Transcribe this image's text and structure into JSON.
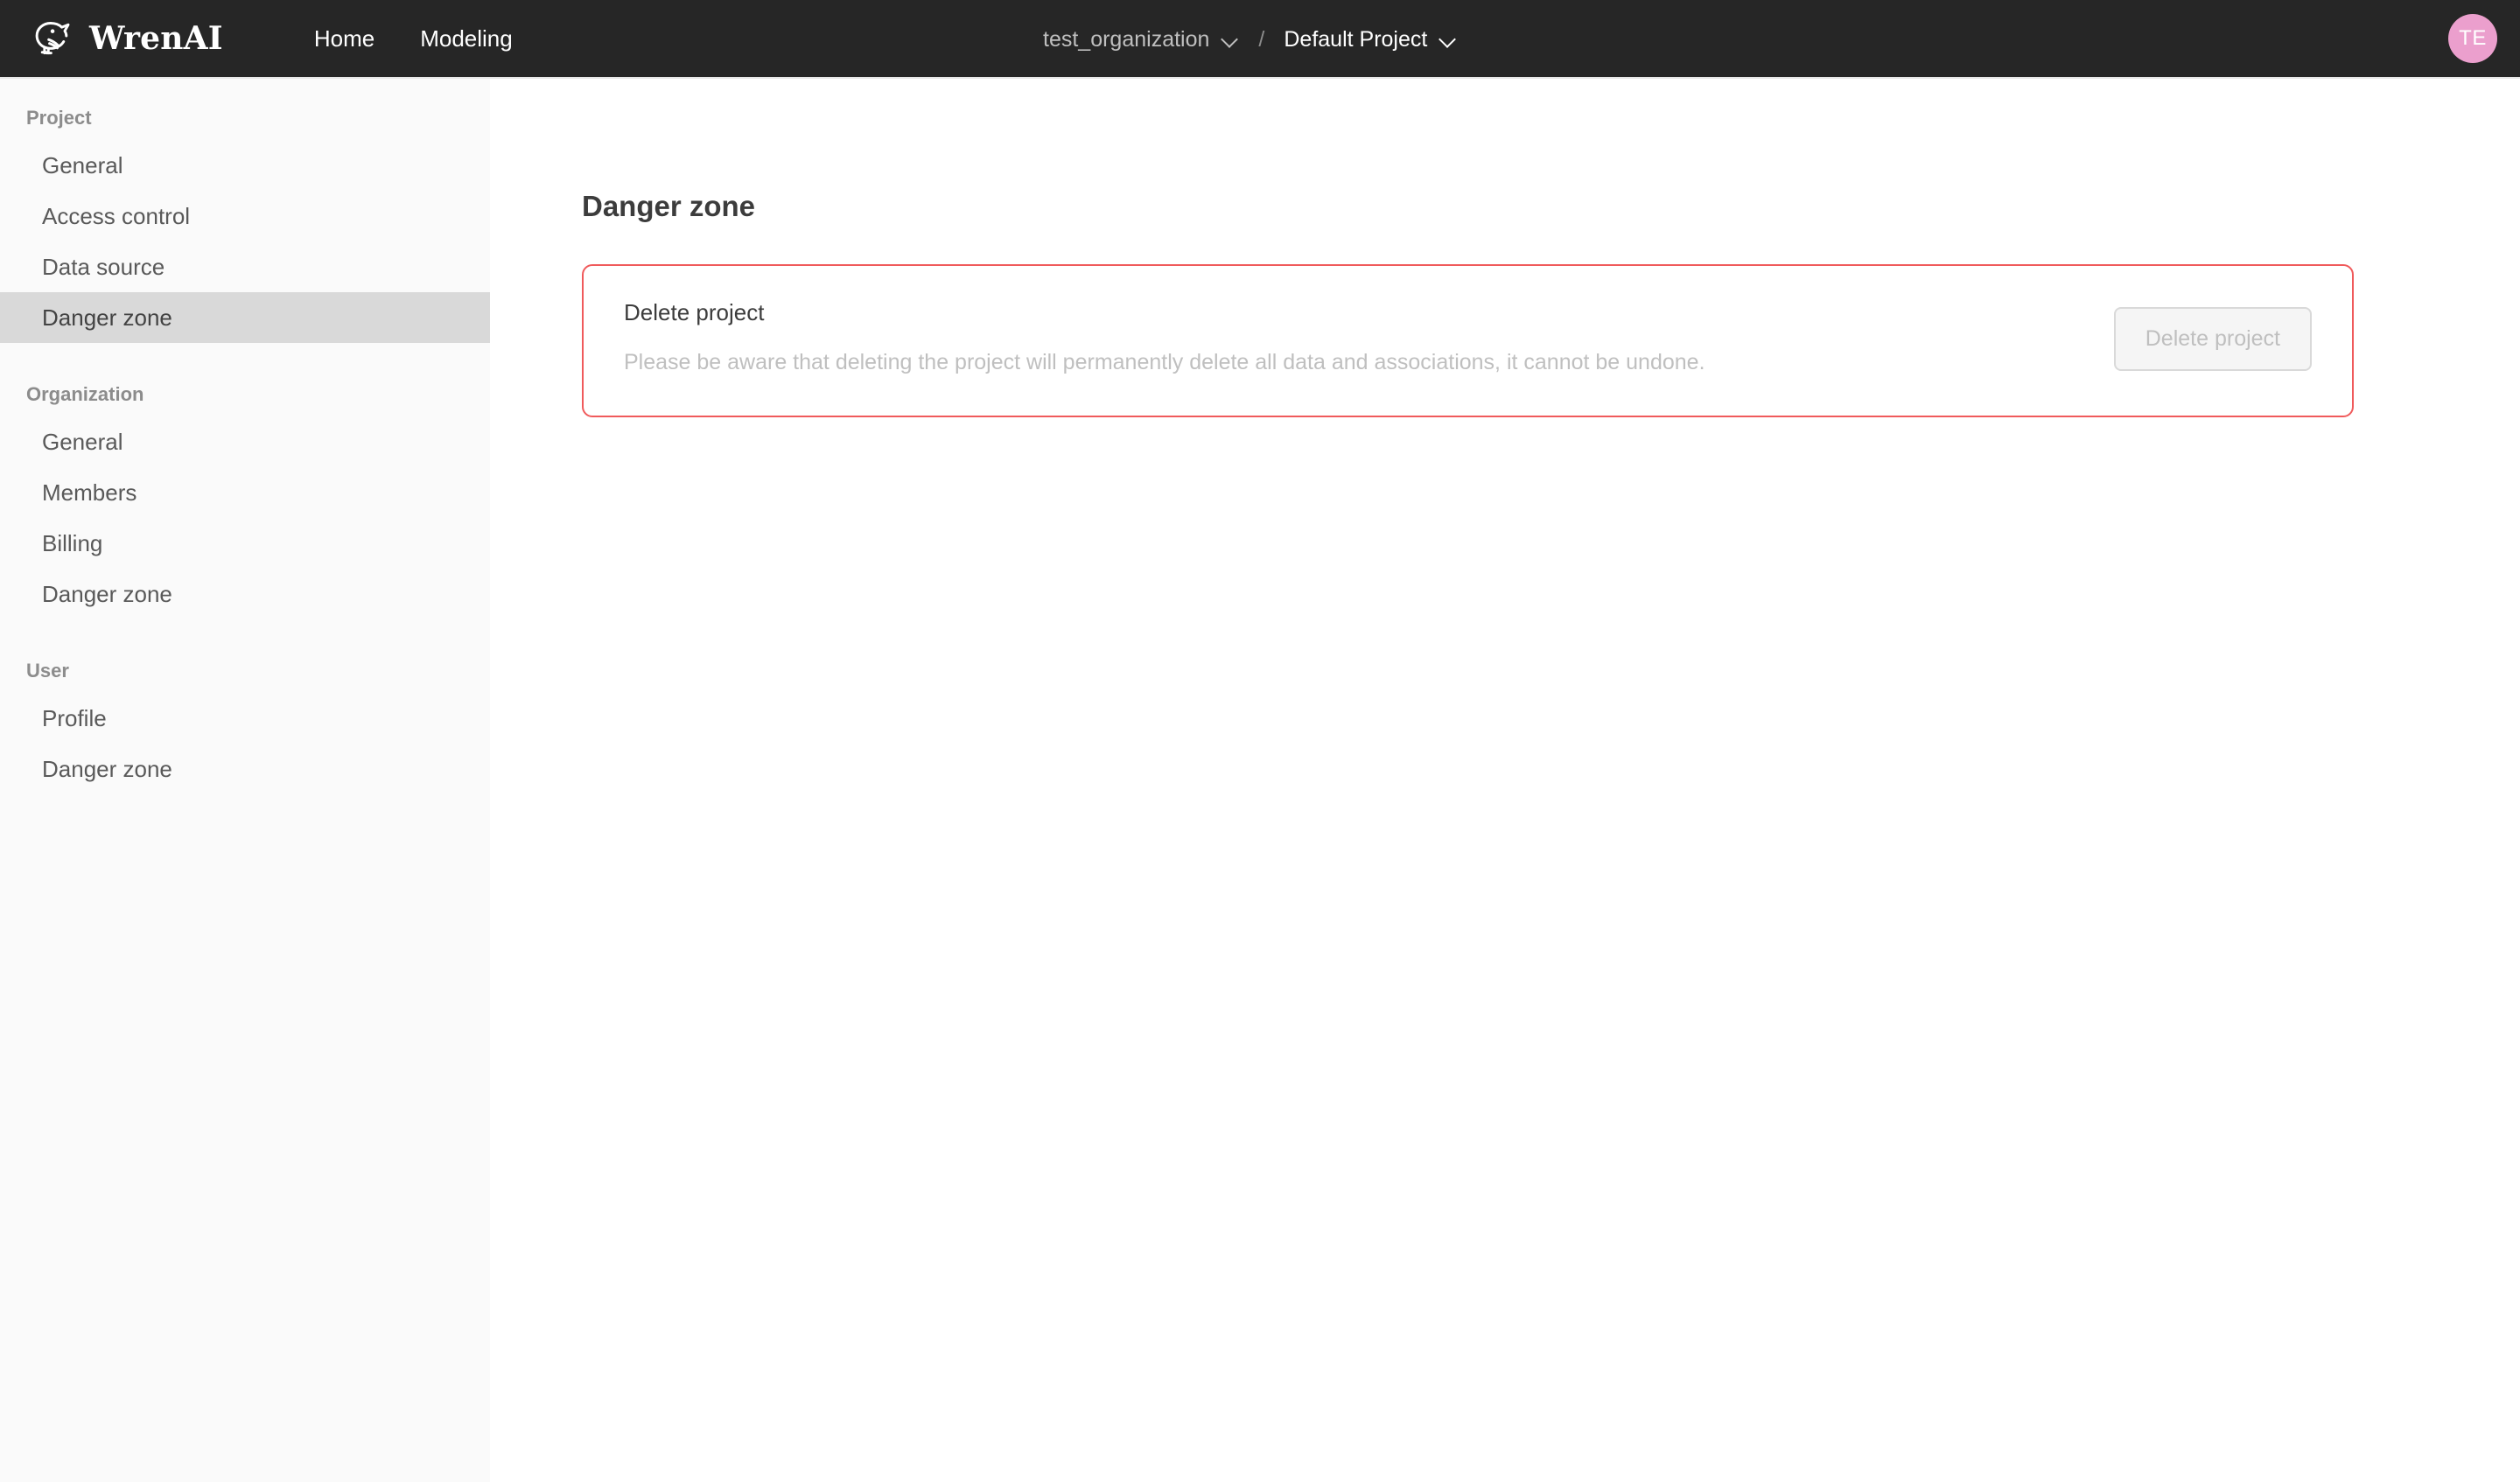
{
  "header": {
    "brand_name": "WrenAI",
    "brand_logo_icon": "wren-bird-icon",
    "nav": [
      {
        "label": "Home",
        "name": "nav-item-home"
      },
      {
        "label": "Modeling",
        "name": "nav-item-modeling"
      }
    ],
    "breadcrumb": {
      "organization": "test_organization",
      "separator": "/",
      "project": "Default Project",
      "chevron_icon": "chevron-down-icon"
    },
    "avatar": {
      "initials": "TE",
      "color": "#eb9fcd"
    },
    "background_color": "#262626"
  },
  "sidebar": {
    "groups": [
      {
        "title": "Project",
        "items": [
          {
            "label": "General",
            "active": false
          },
          {
            "label": "Access control",
            "active": false
          },
          {
            "label": "Data source",
            "active": false
          },
          {
            "label": "Danger zone",
            "active": true
          }
        ]
      },
      {
        "title": "Organization",
        "items": [
          {
            "label": "General",
            "active": false
          },
          {
            "label": "Members",
            "active": false
          },
          {
            "label": "Billing",
            "active": false
          },
          {
            "label": "Danger zone",
            "active": false
          }
        ]
      },
      {
        "title": "User",
        "items": [
          {
            "label": "Profile",
            "active": false
          },
          {
            "label": "Danger zone",
            "active": false
          }
        ]
      }
    ],
    "active_highlight_color": "#d9d9d9",
    "background_color": "#fafafa"
  },
  "main": {
    "page_title": "Danger zone",
    "danger_card": {
      "title": "Delete project",
      "description": "Please be aware that deleting the project will permanently delete all data and associations, it cannot be undone.",
      "button_label": "Delete project",
      "button_disabled": true,
      "border_color": "#f05a5b"
    }
  }
}
